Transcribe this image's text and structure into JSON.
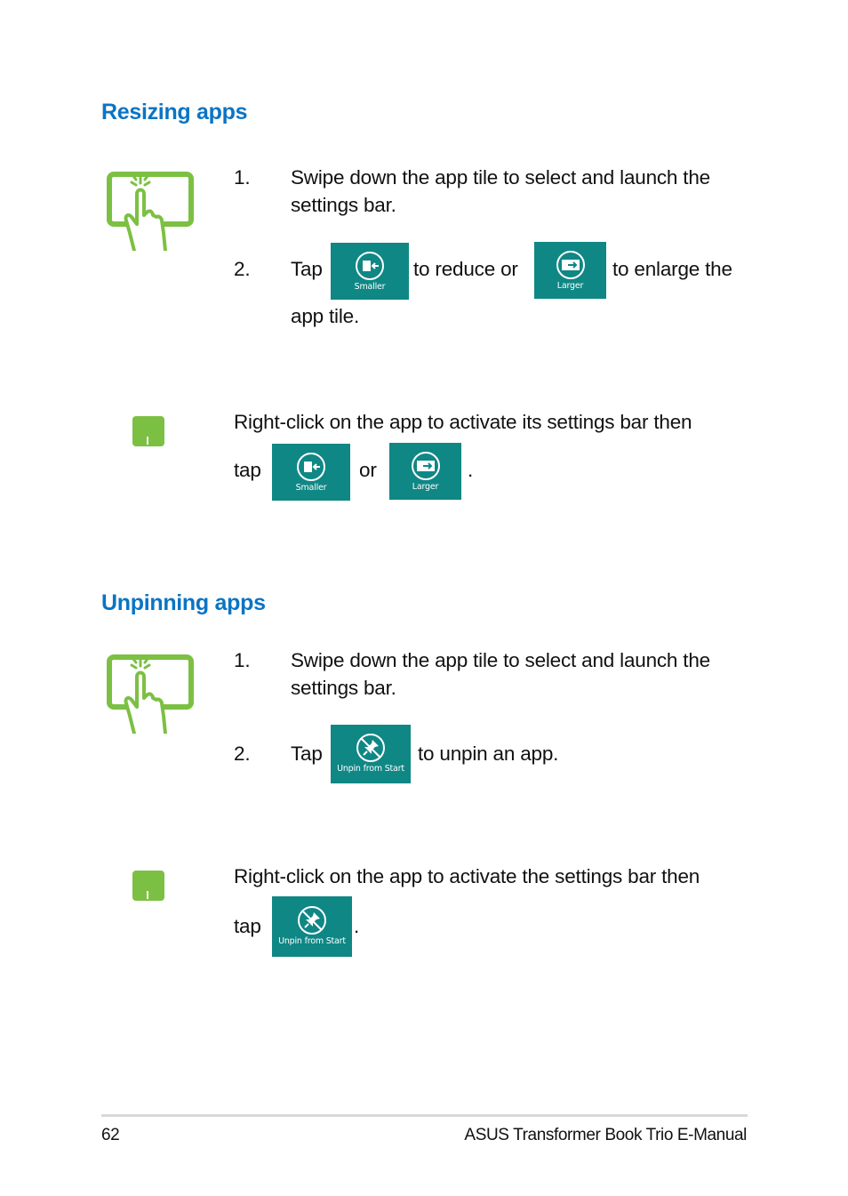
{
  "colors": {
    "heading": "#0a74c4",
    "tile": "#0f8785",
    "icon_green": "#7cc043"
  },
  "sections": [
    {
      "heading": "Resizing apps",
      "touch_gesture_icon": "tap-touchscreen-icon",
      "steps": [
        {
          "number": "1.",
          "line1": "Swipe down the app tile to select and launch the",
          "line2": "settings bar."
        },
        {
          "number": "2.",
          "pre": "Tap",
          "mid": "to reduce or",
          "post": "to enlarge the",
          "line2": "app tile."
        }
      ],
      "touchpad_icon": "touchpad-right-click-icon",
      "note": {
        "line1": "Right-click on the app to activate its settings bar then",
        "pre": "tap",
        "mid": "or",
        "post": "."
      },
      "buttons": {
        "smaller": {
          "label": "Smaller",
          "icon": "smaller-icon"
        },
        "larger": {
          "label": "Larger",
          "icon": "larger-icon"
        }
      }
    },
    {
      "heading": "Unpinning apps",
      "touch_gesture_icon": "tap-touchscreen-icon",
      "steps": [
        {
          "number": "1.",
          "line1": "Swipe down the app tile to select and launch the",
          "line2": "settings bar."
        },
        {
          "number": "2.",
          "pre": "Tap",
          "post": "to unpin an app."
        }
      ],
      "touchpad_icon": "touchpad-right-click-icon",
      "note": {
        "line1": "Right-click on the app to activate the settings bar then",
        "pre": "tap",
        "post": "."
      },
      "buttons": {
        "unpin": {
          "label": "Unpin from Start",
          "icon": "unpin-icon"
        }
      }
    }
  ],
  "footer": {
    "page_number": "62",
    "manual_title": "ASUS Transformer Book Trio E-Manual"
  }
}
